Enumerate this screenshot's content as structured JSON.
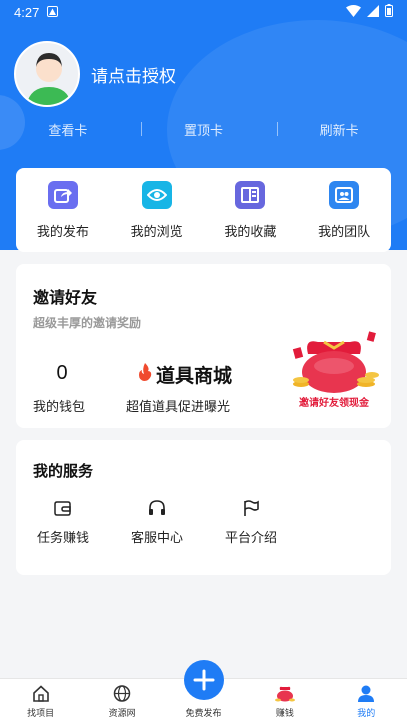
{
  "status_bar": {
    "time": "4:27"
  },
  "profile": {
    "login_prompt": "请点击授权"
  },
  "card_tabs": [
    {
      "label": "查看卡"
    },
    {
      "label": "置顶卡"
    },
    {
      "label": "刷新卡"
    }
  ],
  "quick_actions": [
    {
      "label": "我的发布",
      "icon": "share-icon"
    },
    {
      "label": "我的浏览",
      "icon": "eye-icon"
    },
    {
      "label": "我的收藏",
      "icon": "book-icon"
    },
    {
      "label": "我的团队",
      "icon": "team-icon"
    }
  ],
  "invite": {
    "title": "邀请好友",
    "subtitle": "超级丰厚的邀请奖励",
    "wallet_value": "0",
    "wallet_label": "我的钱包",
    "shop_title": "道具商城",
    "shop_subtitle": "超值道具促进曝光",
    "banner_text": "邀请好友领现金"
  },
  "services": {
    "title": "我的服务",
    "items": [
      {
        "label": "任务赚钱",
        "icon": "wallet-icon"
      },
      {
        "label": "客服中心",
        "icon": "headset-icon"
      },
      {
        "label": "平台介绍",
        "icon": "flag-icon"
      }
    ]
  },
  "tabbar": {
    "items": [
      {
        "label": "找项目",
        "icon": "home-icon"
      },
      {
        "label": "资源网",
        "icon": "globe-icon"
      },
      {
        "label": "免费发布",
        "icon": "plus-icon"
      },
      {
        "label": "赚钱",
        "icon": "money-bag-icon"
      },
      {
        "label": "我的",
        "icon": "user-icon"
      }
    ],
    "active_index": 4
  },
  "colors": {
    "primary": "#1f7cf5",
    "background": "#f4f5f7"
  }
}
